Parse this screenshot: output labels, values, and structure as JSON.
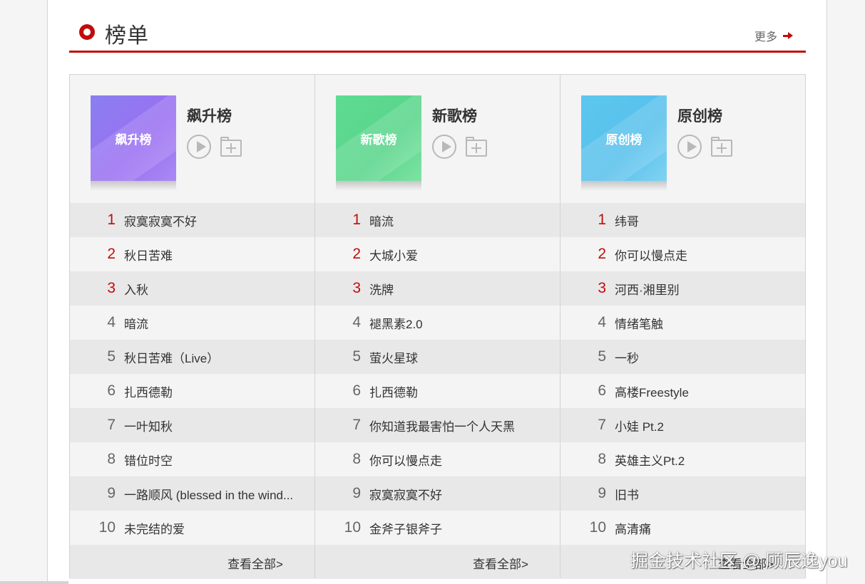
{
  "header": {
    "title": "榜单",
    "more_label": "更多"
  },
  "boards": [
    {
      "name": "飙升榜",
      "cover_text": "飙升榜",
      "cover_color": "#9b7cf2",
      "view_all": "查看全部>",
      "songs": [
        {
          "rank": "1",
          "title": "寂寞寂寞不好"
        },
        {
          "rank": "2",
          "title": "秋日苦难"
        },
        {
          "rank": "3",
          "title": "入秋"
        },
        {
          "rank": "4",
          "title": "暗流"
        },
        {
          "rank": "5",
          "title": "秋日苦难（Live）"
        },
        {
          "rank": "6",
          "title": "扎西德勒"
        },
        {
          "rank": "7",
          "title": "一叶知秋"
        },
        {
          "rank": "8",
          "title": "错位时空"
        },
        {
          "rank": "9",
          "title": "一路顺风 (blessed in the wind..."
        },
        {
          "rank": "10",
          "title": "未完结的爱"
        }
      ]
    },
    {
      "name": "新歌榜",
      "cover_text": "新歌榜",
      "cover_color": "#5cd98f",
      "view_all": "查看全部>",
      "songs": [
        {
          "rank": "1",
          "title": "暗流"
        },
        {
          "rank": "2",
          "title": "大城小爱"
        },
        {
          "rank": "3",
          "title": "洗牌"
        },
        {
          "rank": "4",
          "title": "褪黑素2.0"
        },
        {
          "rank": "5",
          "title": "萤火星球"
        },
        {
          "rank": "6",
          "title": "扎西德勒"
        },
        {
          "rank": "7",
          "title": "你知道我最害怕一个人天黑"
        },
        {
          "rank": "8",
          "title": "你可以慢点走"
        },
        {
          "rank": "9",
          "title": "寂寞寂寞不好"
        },
        {
          "rank": "10",
          "title": "金斧子银斧子"
        }
      ]
    },
    {
      "name": "原创榜",
      "cover_text": "原创榜",
      "cover_color": "#5cc4ee",
      "view_all": "查看全部>",
      "songs": [
        {
          "rank": "1",
          "title": "纬哥"
        },
        {
          "rank": "2",
          "title": "你可以慢点走"
        },
        {
          "rank": "3",
          "title": "河西·湘里别"
        },
        {
          "rank": "4",
          "title": "情绪笔触"
        },
        {
          "rank": "5",
          "title": "一秒"
        },
        {
          "rank": "6",
          "title": "高楼Freestyle"
        },
        {
          "rank": "7",
          "title": "小娃 Pt.2"
        },
        {
          "rank": "8",
          "title": "英雄主义Pt.2"
        },
        {
          "rank": "9",
          "title": "旧书"
        },
        {
          "rank": "10",
          "title": "高清痛"
        }
      ]
    }
  ],
  "watermark": "掘金技术社区 @ 顾辰逸you",
  "accent_color": "#c20c0c"
}
